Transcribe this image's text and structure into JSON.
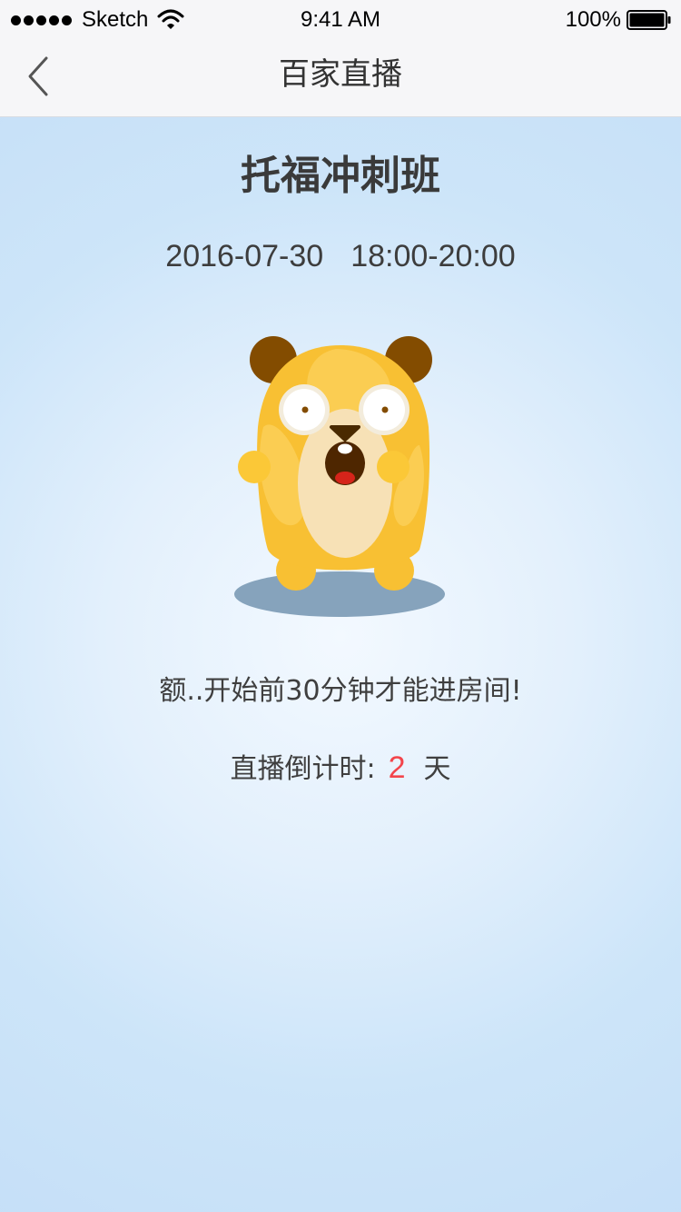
{
  "status_bar": {
    "carrier": "Sketch",
    "time": "9:41 AM",
    "battery": "100%",
    "signal_icon": "signal-dots-icon",
    "wifi_icon": "wifi-icon",
    "battery_icon": "battery-icon"
  },
  "nav": {
    "title": "百家直播",
    "back_icon": "chevron-left-icon"
  },
  "course": {
    "title": "托福冲刺班",
    "date": "2016-07-30",
    "time_range": "18:00-20:00"
  },
  "mascot": {
    "icon": "hamster-mascot-icon"
  },
  "notice": {
    "text": "额..开始前30分钟才能进房间!"
  },
  "countdown": {
    "label": "直播倒计时:",
    "value": "2",
    "unit": "天"
  },
  "colors": {
    "countdown_value": "#f3454b",
    "background": "#cde5f9",
    "nav_background": "#f6f6f8"
  }
}
